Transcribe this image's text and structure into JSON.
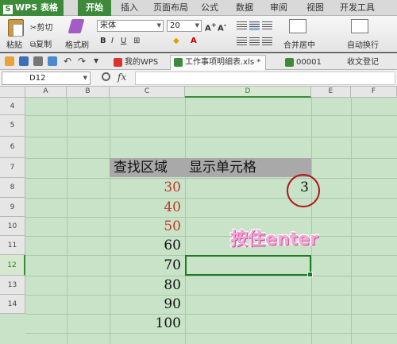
{
  "app": {
    "name": "WPS 表格"
  },
  "ribbon_tabs": [
    "开始",
    "插入",
    "页面布局",
    "公式",
    "数据",
    "审阅",
    "视图",
    "开发工具"
  ],
  "ribbon": {
    "cut": "剪切",
    "paste": "粘贴",
    "copy": "复制",
    "format_painter": "格式刷",
    "font_name": "宋体",
    "font_size": "20",
    "merge_center": "合并居中",
    "wrap_text": "自动换行"
  },
  "doc_tabs": [
    {
      "label": "我的WPS",
      "active": false
    },
    {
      "label": "工作事项明细表.xls *",
      "active": true
    },
    {
      "label": "00001",
      "active": false
    },
    {
      "label": "收文登记簿.xls",
      "active": false
    }
  ],
  "formula_bar": {
    "cell_ref": "D12",
    "fx": "fx",
    "value": ""
  },
  "grid": {
    "columns": [
      "A",
      "B",
      "C",
      "D",
      "E",
      "F"
    ],
    "active_column": "D",
    "rows": [
      "4",
      "5",
      "6",
      "7",
      "8",
      "9",
      "10",
      "11",
      "12",
      "13",
      "14"
    ],
    "active_row": "12",
    "header_c": "查找区域",
    "header_d": "显示单元格",
    "values": [
      {
        "row": "8",
        "value": "30",
        "color": "#c0392b"
      },
      {
        "row": "9",
        "value": "40",
        "color": "#c0392b"
      },
      {
        "row": "10",
        "value": "50",
        "color": "#c0392b"
      },
      {
        "row": "11",
        "value": "60",
        "color": "#111111"
      },
      {
        "row": "12",
        "value": "70",
        "color": "#111111"
      },
      {
        "row": "13",
        "value": "80",
        "color": "#111111"
      },
      {
        "row": "14",
        "value": "90",
        "color": "#111111"
      },
      {
        "row": "15",
        "value": "100",
        "color": "#111111"
      }
    ],
    "result_d8": "3",
    "selected_cell": "D12"
  },
  "overlay_caption": "按住enter",
  "colors": {
    "accent": "#3c8a3a",
    "grid_bg": "#c9e3c8",
    "highlight_ring": "#b0141a",
    "red_values": "#c0392b"
  }
}
